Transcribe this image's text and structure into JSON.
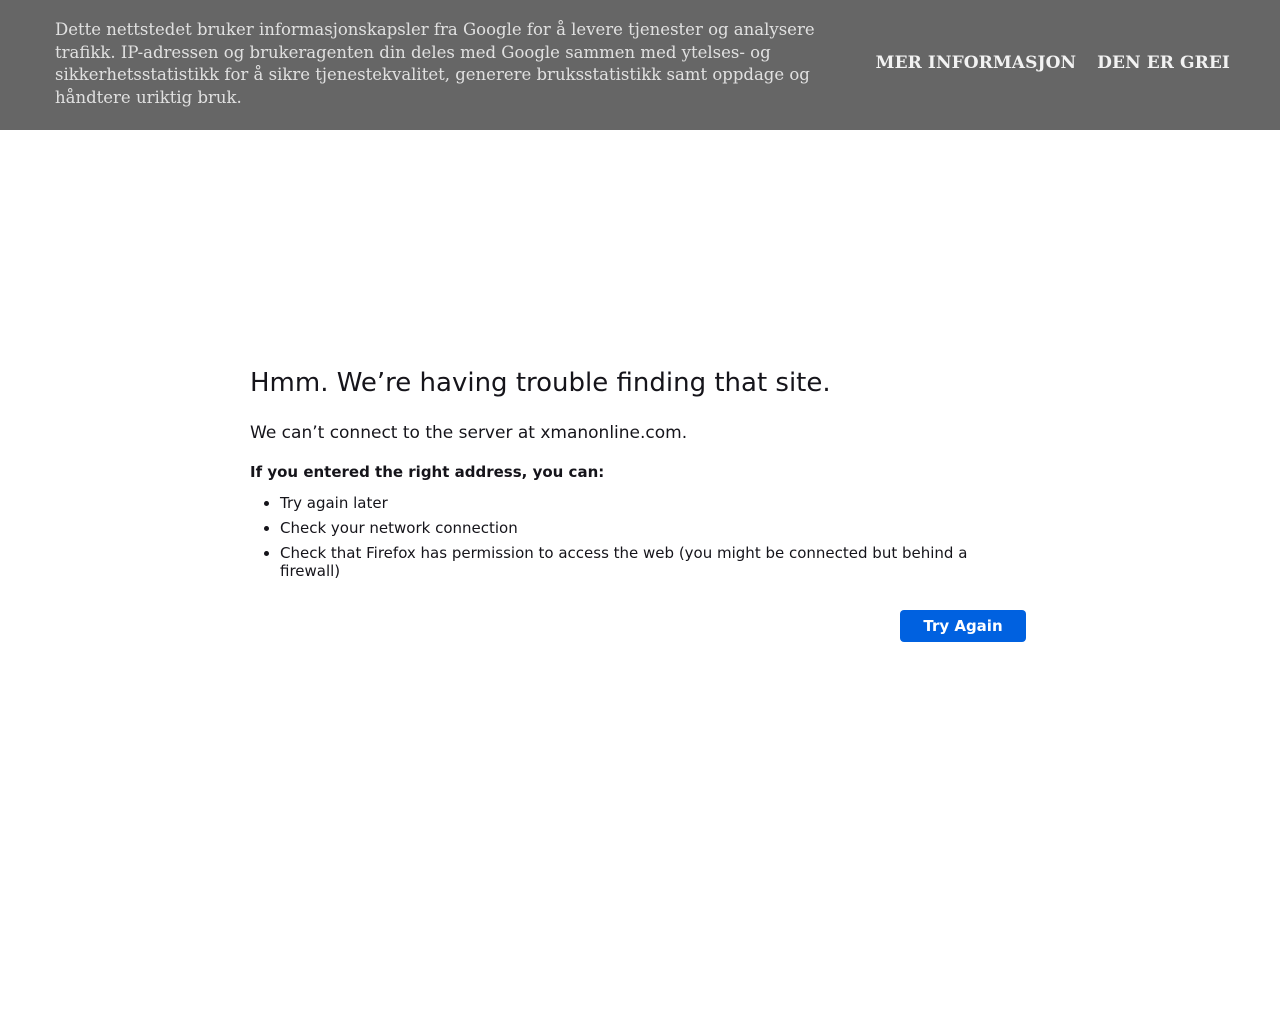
{
  "cookie_banner": {
    "message": "Dette nettstedet bruker informasjonskapsler fra Google for å levere tjenester og analysere trafikk. IP-adressen og brukeragenten din deles med Google sammen med ytelses- og sikkerhetsstatistikk for å sikre tjenestekvalitet, generere bruksstatistikk samt oppdage og håndtere uriktig bruk.",
    "more_info_label": "MER INFORMASJON",
    "accept_label": "DEN ER GREI"
  },
  "error_page": {
    "title": "Hmm. We’re having trouble finding that site.",
    "subtitle": "We can’t connect to the server at xmanonline.com.",
    "hint_heading": "If you entered the right address, you can:",
    "suggestions": [
      "Try again later",
      "Check your network connection",
      "Check that Firefox has permission to access the web (you might be connected but behind a firewall)"
    ],
    "try_again_label": "Try Again"
  },
  "colors": {
    "banner_background": "#666666",
    "button_accent": "#0061e0"
  }
}
